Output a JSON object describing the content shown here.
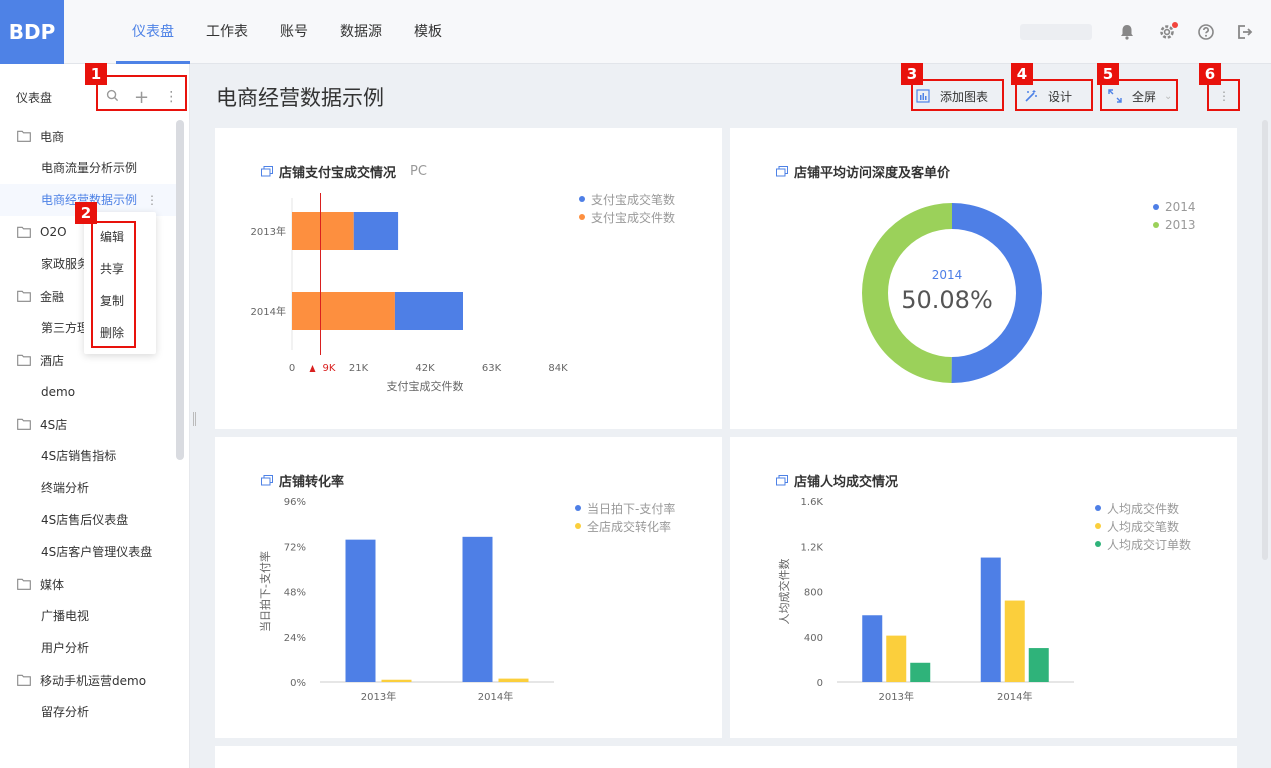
{
  "app": {
    "logo": "BDP"
  },
  "nav": {
    "items": [
      "仪表盘",
      "工作表",
      "账号",
      "数据源",
      "模板"
    ],
    "active": 0
  },
  "sidebar": {
    "title": "仪表盘",
    "tools": {
      "search": "search-icon",
      "add": "+",
      "more": "⋮"
    },
    "groups": [
      {
        "folder": "电商",
        "items": [
          "电商流量分析示例",
          "电商经营数据示例"
        ]
      },
      {
        "folder": "O2O",
        "items": [
          "家政服务"
        ]
      },
      {
        "folder": "金融",
        "items": [
          "第三方理"
        ]
      },
      {
        "folder": "酒店",
        "items": [
          "demo"
        ]
      },
      {
        "folder": "4S店",
        "items": [
          "4S店销售指标",
          "终端分析",
          "4S店售后仪表盘",
          "4S店客户管理仪表盘"
        ]
      },
      {
        "folder": "媒体",
        "items": [
          "广播电视",
          "用户分析"
        ]
      },
      {
        "folder": "移动手机运营demo",
        "items": [
          "留存分析"
        ]
      }
    ],
    "active_item": "电商经营数据示例",
    "item_more": "⋮"
  },
  "context_menu": {
    "items": [
      "编辑",
      "共享",
      "复制",
      "删除"
    ]
  },
  "annotations": [
    "1",
    "2",
    "3",
    "4",
    "5",
    "6"
  ],
  "page": {
    "title": "电商经营数据示例",
    "buttons": {
      "add_chart": "添加图表",
      "design": "设计",
      "fullscreen": "全屏",
      "more": "⋮"
    }
  },
  "colors": {
    "accent": "#4e82e6",
    "blue": "#4e7fe6",
    "orange": "#fd8f3f",
    "green": "#9bd15a",
    "yellow": "#fbcf3c",
    "teal": "#2fb37a",
    "annotation": "#e8120c"
  },
  "chart_data": [
    {
      "type": "bar",
      "orientation": "horizontal",
      "stacked": true,
      "title": "店铺支付宝成交情况",
      "subtitle": "PC",
      "categories": [
        "2013年",
        "2014年"
      ],
      "series": [
        {
          "name": "支付宝成交件数",
          "values": [
            19500,
            32500
          ]
        },
        {
          "name": "支付宝成交笔数",
          "values": [
            14000,
            21500
          ]
        }
      ],
      "legend": [
        "支付宝成交笔数",
        "支付宝成交件数"
      ],
      "xlabel": "支付宝成交件数",
      "xticks": [
        "0",
        "21K",
        "42K",
        "63K",
        "84K"
      ],
      "xlim": [
        0,
        84000
      ],
      "reference_line": {
        "value": 9000,
        "label": "9K"
      },
      "legend_position": "top-right"
    },
    {
      "type": "pie",
      "donut": true,
      "title": "店铺平均访问深度及客单价",
      "labels": [
        "2014",
        "2013"
      ],
      "values": [
        50.08,
        49.92
      ],
      "center_label": "2014",
      "center_value": "50.08%",
      "legend_position": "top-right"
    },
    {
      "type": "bar",
      "title": "店铺转化率",
      "categories": [
        "2013年",
        "2014年"
      ],
      "series": [
        {
          "name": "当日拍下-支付率",
          "values": [
            75.5,
            77
          ]
        },
        {
          "name": "全店成交转化率",
          "values": [
            1.2,
            1.8
          ]
        }
      ],
      "ylabel": "当日拍下-支付率",
      "yticks": [
        "0%",
        "24%",
        "48%",
        "72%",
        "96%"
      ],
      "ylim": [
        0,
        96
      ],
      "legend_position": "top-right"
    },
    {
      "type": "bar",
      "title": "店铺人均成交情况",
      "categories": [
        "2013年",
        "2014年"
      ],
      "series": [
        {
          "name": "人均成交件数",
          "values": [
            590,
            1100
          ]
        },
        {
          "name": "人均成交笔数",
          "values": [
            410,
            720
          ]
        },
        {
          "name": "人均成交订单数",
          "values": [
            170,
            300
          ]
        }
      ],
      "ylabel": "人均成交件数",
      "yticks": [
        "0",
        "400",
        "800",
        "1.2K",
        "1.6K"
      ],
      "ylim": [
        0,
        1600
      ],
      "legend_position": "top-right"
    }
  ]
}
